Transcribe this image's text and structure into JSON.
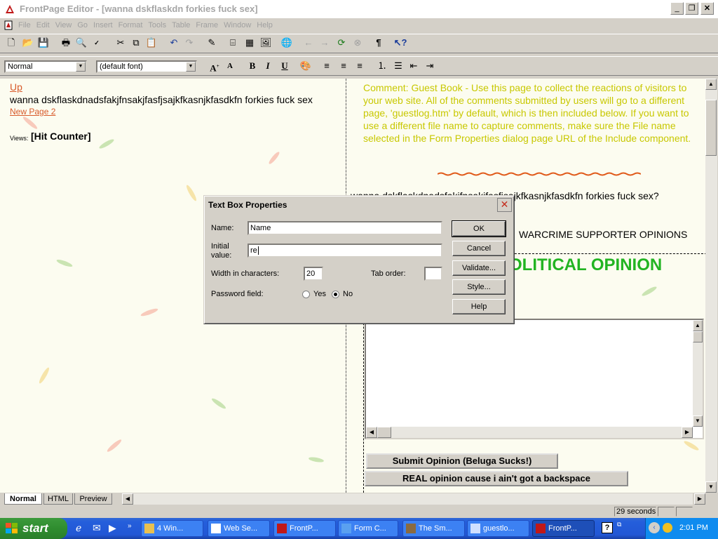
{
  "window": {
    "title": "FrontPage Editor - [wanna dskflaskdn forkies fuck sex]",
    "buttons": [
      "_",
      "❐",
      "✕"
    ]
  },
  "menubar": [
    "File",
    "Edit",
    "View",
    "Go",
    "Insert",
    "Format",
    "Tools",
    "Table",
    "Frame",
    "Window",
    "Help"
  ],
  "format_toolbar": {
    "style_value": "Normal",
    "font_value": "(default font)",
    "bold": "B",
    "italic": "I",
    "underline": "U"
  },
  "left_frame": {
    "link_up": "Up",
    "heading": "wanna dskflaskdnadsfakjfnsakjfasfjsajkfkasnjkfasdkfn forkies fuck sex",
    "link_page2": "New Page 2",
    "views_label": "Views:",
    "hit_counter": "[Hit Counter]"
  },
  "right_frame": {
    "comment": "Comment: Guest Book - Use this page to collect the reactions of visitors to your web site. All of the comments submitted by users will go to a different page, 'guestlog.htm' by default, which is then included below. If you want to use a different file name to capture comments, make sure the File name selected in the Form Properties dialog page URL of the Include component.",
    "question": "wanna dskflaskdnadsfakjfnsakjfasfjsajkfkasnjkfasdkfn forkies fuck sex?",
    "partial_warcrime": "WARCRIME SUPPORTER OPINIONS",
    "partial_heading": "OLITICAL OPINION",
    "submit_button": "Submit Opinion (Beluga Sucks!)",
    "real_button": "REAL opinion cause i ain't got a backspace"
  },
  "dialog": {
    "title": "Text Box Properties",
    "name_label": "Name:",
    "name_value": "Name",
    "initial_label_1": "Initial",
    "initial_label_2": "value:",
    "initial_value": "re",
    "width_label": "Width in characters:",
    "width_value": "20",
    "tab_order_label": "Tab order:",
    "tab_order_value": "",
    "password_label": "Password field:",
    "radio_yes": "Yes",
    "radio_no": "No",
    "password_selected": "No",
    "ok": "OK",
    "cancel": "Cancel",
    "validate": "Validate...",
    "style": "Style...",
    "help": "Help"
  },
  "view_tabs": [
    "Normal",
    "HTML",
    "Preview"
  ],
  "status": {
    "time": "29 seconds"
  },
  "taskbar": {
    "start": "start",
    "tasks": [
      {
        "label": "4 Win..."
      },
      {
        "label": "Web Se..."
      },
      {
        "label": "FrontP..."
      },
      {
        "label": "Form C..."
      },
      {
        "label": "The Sm..."
      },
      {
        "label": "guestlo..."
      },
      {
        "label": "FrontP..."
      }
    ],
    "clock": "2:01 PM"
  },
  "colors": {
    "comment_text": "#c8c800",
    "heading_green": "#22b422",
    "link": "#d85a2a",
    "taskbar_blue": "#245edb",
    "start_green": "#2f8d2f"
  }
}
